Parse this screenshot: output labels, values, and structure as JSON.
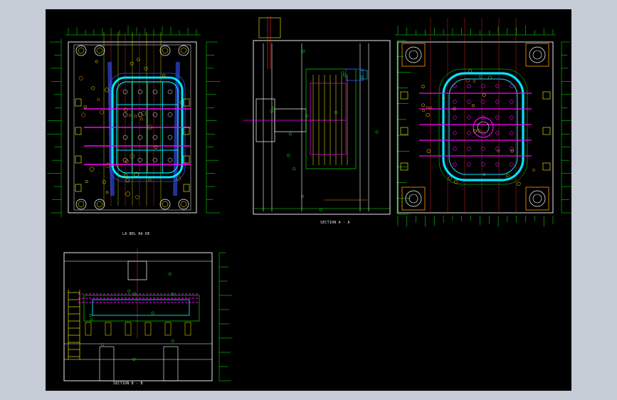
{
  "colors": {
    "outer_background": "#c6ccd6",
    "canvas": "#000000",
    "plate": "#ffffff",
    "dimension": "#00ff00",
    "accent_cyan": "#00e5ff",
    "accent_magenta": "#ff00ff",
    "accent_yellow": "#ffff00",
    "accent_red": "#ff3030",
    "accent_blue": "#3355ff",
    "accent_orange": "#ff9a00"
  },
  "views": [
    {
      "id": "plan-view",
      "caption": "LA BEL RA RE",
      "content": "top plan of moving half with cavity, cooling lines and bolt circles"
    },
    {
      "id": "section-a",
      "caption": "SECTION A - A",
      "content": "side section with ejector stack"
    },
    {
      "id": "plan-view-2",
      "caption": "",
      "content": "top plan of fixed half with four corner guide blocks and rounded cavity"
    },
    {
      "id": "section-b",
      "caption": "SECTION B - B",
      "content": "front section with plate stack"
    }
  ]
}
